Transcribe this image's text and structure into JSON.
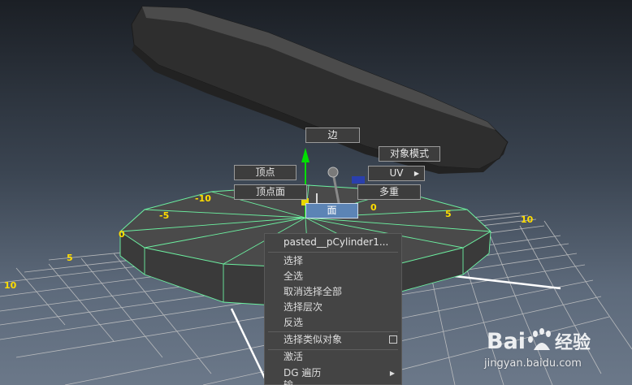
{
  "marking_menu": {
    "edge": "边",
    "object_mode": "对象模式",
    "vertex": "顶点",
    "uv": "UV",
    "vertex_face": "顶点面",
    "multi": "多重",
    "face": "面"
  },
  "grid_labels": {
    "neg10": "-10",
    "neg5": "-5",
    "zero_left": "0",
    "zero_right": "0",
    "five_right": "5",
    "ten_right": "10",
    "five_left": "5",
    "ten_left": "10"
  },
  "context_menu": {
    "header": "pasted__pCylinder1...",
    "select": "选择",
    "select_all": "全选",
    "deselect_all": "取消选择全部",
    "select_hierarchy": "选择层次",
    "invert": "反选",
    "select_similar": "选择类似对象",
    "activate": "激活",
    "dg_traversal": "DG 遍历",
    "partial": "输..."
  },
  "watermark": {
    "brand": "Baidu经验",
    "url": "jingyan.baidu.com"
  },
  "colors": {
    "wire_green": "#6cf0a0",
    "menu_active": "#5c84b5",
    "grid_label": "#ffdd00"
  }
}
